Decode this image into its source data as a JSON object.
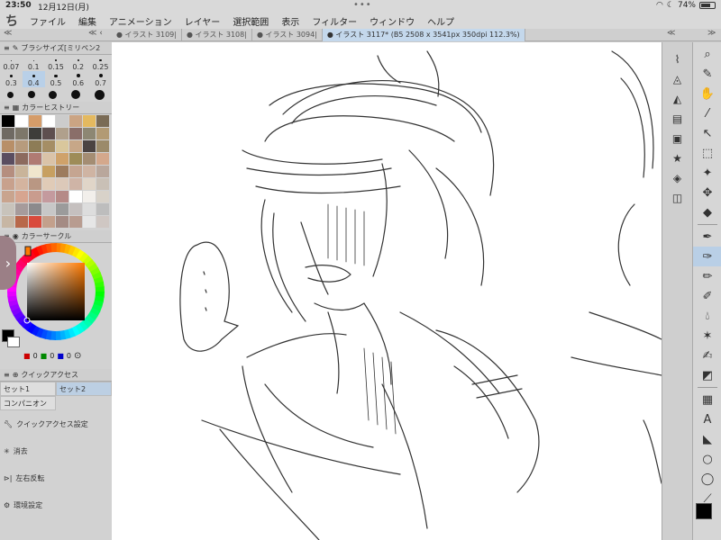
{
  "status": {
    "time": "23:50",
    "date": "12月12日(月)",
    "dots": "•••",
    "battery": "74%",
    "battery_level": 0.74
  },
  "menu": {
    "logo": "ち",
    "items": [
      "ファイル",
      "編集",
      "アニメーション",
      "レイヤー",
      "選択範囲",
      "表示",
      "フィルター",
      "ウィンドウ",
      "ヘルプ"
    ]
  },
  "tabs": {
    "left_nav": "≪",
    "right_nav": "≪ ‹",
    "far_right_nav": "≫",
    "items": [
      {
        "label": "● イラスト 3109|",
        "active": false
      },
      {
        "label": "● イラスト 3108|",
        "active": false
      },
      {
        "label": "● イラスト 3094|",
        "active": false
      },
      {
        "label": "● イラスト 3117* (B5 2508 x 3541px 350dpi 112.3%)",
        "active": true
      }
    ]
  },
  "brush_panel": {
    "title": "ブラシサイズ[ミリペン2",
    "sizes": [
      "0.07",
      "0.1",
      "0.15",
      "0.2",
      "0.25",
      "0.3",
      "0.4",
      "0.5",
      "0.6",
      "0.7"
    ],
    "selected": "0.4"
  },
  "history_panel": {
    "title": "カラーヒストリー",
    "swatches": [
      "#000000",
      "#ffffff",
      "#d59c69",
      "#ffffff",
      "#cccccc",
      "#cba483",
      "#e4b95f",
      "#7a6b55",
      "#6f6a63",
      "#7d776a",
      "#3e3d3a",
      "#5e4f4f",
      "#b0a08c",
      "#8a6e69",
      "#8d8773",
      "#b29a74",
      "#b88f68",
      "#b79b7d",
      "#8d7c56",
      "#a58e65",
      "#d9c79c",
      "#c7a788",
      "#4a4342",
      "#9b8a6a",
      "#5a4d60",
      "#8c6a5e",
      "#b07b73",
      "#dac3a8",
      "#cfa26a",
      "#9e8c58",
      "#a48d73",
      "#d4a88c",
      "#b58e7f",
      "#c9b49a",
      "#f0e6cd",
      "#c7a061",
      "#9d7c5e",
      "#c5a591",
      "#cfb4a3",
      "#b9a79c",
      "#c8a18d",
      "#d4b49f",
      "#b99783",
      "#e0cbb7",
      "#dcc9b9",
      "#cfb4a6",
      "#e0d5c8",
      "#c9c0b6",
      "#c9a48e",
      "#d7a590",
      "#c99c8e",
      "#c49a9e",
      "#b58a87",
      "#ffffff",
      "#f2efeb",
      "#d8d2c9",
      "#c8c3bb",
      "#a69b9b",
      "#8c8a8c",
      "#c7c7c7",
      "#9b9b9b",
      "#c5c0bf",
      "#dddddd",
      "#bdbdbd",
      "#c7b6a4",
      "#b8684a",
      "#d94a3c",
      "#c3a08c",
      "#a48b84",
      "#b89c90",
      "#e6e6e6",
      "#cfc7c3"
    ]
  },
  "color_panel": {
    "title": "カラーサークル",
    "main_color": "#000000",
    "sub_color": "#ffffff",
    "hue_color": "#ff7a00",
    "r": "0",
    "g": "0",
    "b": "0"
  },
  "quick_access": {
    "title": "クイックアクセス",
    "set1": "セット1",
    "set2": "セット2",
    "companion": "コンパニオン",
    "items": [
      "クイックアクセス設定",
      "消去",
      "左右反転",
      "環境設定"
    ]
  },
  "accent": "#b9cfe6"
}
